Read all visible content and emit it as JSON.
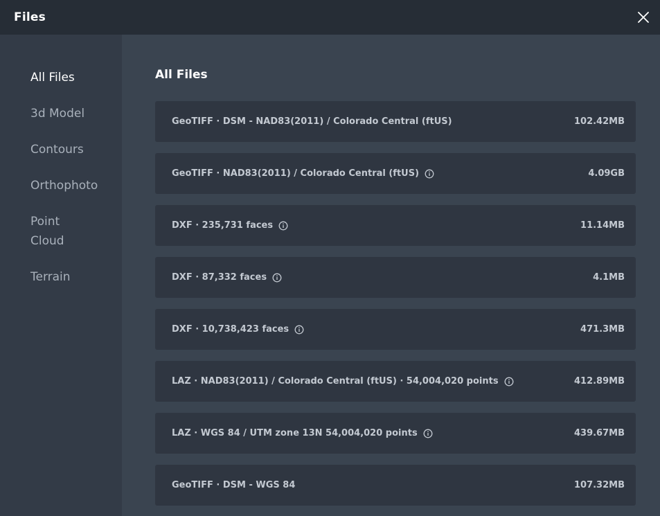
{
  "window": {
    "title": "Files"
  },
  "sidebar": {
    "items": [
      {
        "label": "All Files"
      },
      {
        "label": "3d Model"
      },
      {
        "label": "Contours"
      },
      {
        "label": "Orthophoto"
      },
      {
        "label": "Point Cloud"
      },
      {
        "label": "Terrain"
      }
    ],
    "active": "All Files"
  },
  "main": {
    "heading": "All Files",
    "files": [
      {
        "label": "GeoTIFF · DSM - NAD83(2011) / Colorado Central (ftUS)",
        "size": "102.42MB",
        "info_icon": false
      },
      {
        "label": "GeoTIFF · NAD83(2011) / Colorado Central (ftUS)",
        "size": "4.09GB",
        "info_icon": true
      },
      {
        "label": "DXF · 235,731 faces",
        "size": "11.14MB",
        "info_icon": true
      },
      {
        "label": "DXF · 87,332 faces",
        "size": "4.1MB",
        "info_icon": true
      },
      {
        "label": "DXF · 10,738,423 faces",
        "size": "471.3MB",
        "info_icon": true
      },
      {
        "label": "LAZ · NAD83(2011) / Colorado Central (ftUS) · 54,004,020 points",
        "size": "412.89MB",
        "info_icon": true
      },
      {
        "label": "LAZ · WGS 84 / UTM zone 13N 54,004,020 points",
        "size": "439.67MB",
        "info_icon": true
      },
      {
        "label": "GeoTIFF · DSM - WGS 84",
        "size": "107.32MB",
        "info_icon": false
      }
    ]
  },
  "icons": {
    "close": "close-icon",
    "info": "info-icon"
  },
  "colors": {
    "titlebar_bg": "#262d36",
    "sidebar_bg": "#333b47",
    "main_bg": "#3a4450",
    "row_bg": "#2f3641",
    "text_primary": "#ffffff",
    "text_secondary": "#c3c9d1"
  }
}
